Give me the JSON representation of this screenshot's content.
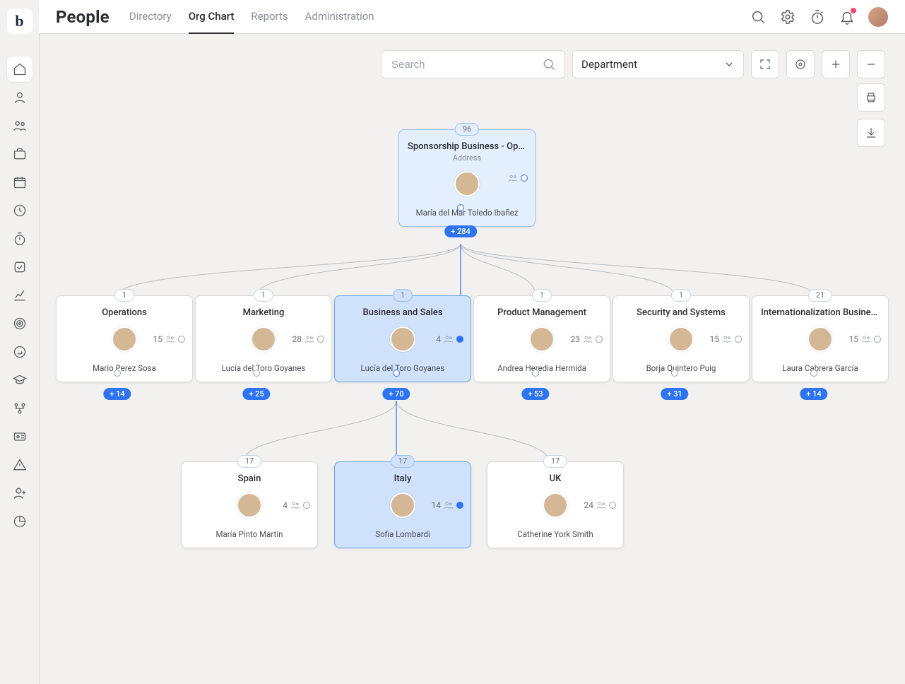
{
  "app": {
    "title": "People"
  },
  "tabs": [
    {
      "label": "Directory",
      "active": false
    },
    {
      "label": "Org Chart",
      "active": true
    },
    {
      "label": "Reports",
      "active": false
    },
    {
      "label": "Administration",
      "active": false
    }
  ],
  "search": {
    "placeholder": "Search"
  },
  "dropdown": {
    "label": "Department"
  },
  "rail_icons": [
    "home-icon",
    "profile-icon",
    "people-icon",
    "briefcase-icon",
    "calendar-icon",
    "clock-icon",
    "timer-icon",
    "checkbox-icon",
    "chart-icon",
    "target-icon",
    "support-icon",
    "graduation-icon",
    "branch-icon",
    "id-icon",
    "warning-icon",
    "user-plus-icon",
    "pie-icon"
  ],
  "root": {
    "badge": "96",
    "dept": "Sponsorship Business - Operati…",
    "sub": "Address",
    "name": "María del Mar Toledo Ibañez",
    "expand": "+ 284"
  },
  "level2": [
    {
      "badge": "1",
      "dept": "Operations",
      "count": "15",
      "name": "Mario Perez Sosa",
      "expand": "+ 14"
    },
    {
      "badge": "1",
      "dept": "Marketing",
      "count": "28",
      "name": "Lucía del Toro Goyanes",
      "expand": "+ 25"
    },
    {
      "badge": "1",
      "dept": "Business and Sales",
      "count": "4",
      "name": "Lucía del Toro Goyanes",
      "expand": "+ 70",
      "selected": true
    },
    {
      "badge": "1",
      "dept": "Product Management",
      "count": "23",
      "name": "Andrea Heredia Hermida",
      "expand": "+ 53"
    },
    {
      "badge": "1",
      "dept": "Security and Systems",
      "count": "15",
      "name": "Borja Quintero Puig",
      "expand": "+ 31"
    },
    {
      "badge": "21",
      "dept": "Internationalization Business St…",
      "count": "15",
      "name": "Laura Cabrera García",
      "expand": "+ 14"
    }
  ],
  "level3": [
    {
      "badge": "17",
      "dept": "Spain",
      "count": "4",
      "name": "María Pinto Martín"
    },
    {
      "badge": "17",
      "dept": "Italy",
      "count": "14",
      "name": "Sofia Lombardi",
      "selected": true
    },
    {
      "badge": "17",
      "dept": "UK",
      "count": "24",
      "name": "Catherine York Smith"
    }
  ]
}
